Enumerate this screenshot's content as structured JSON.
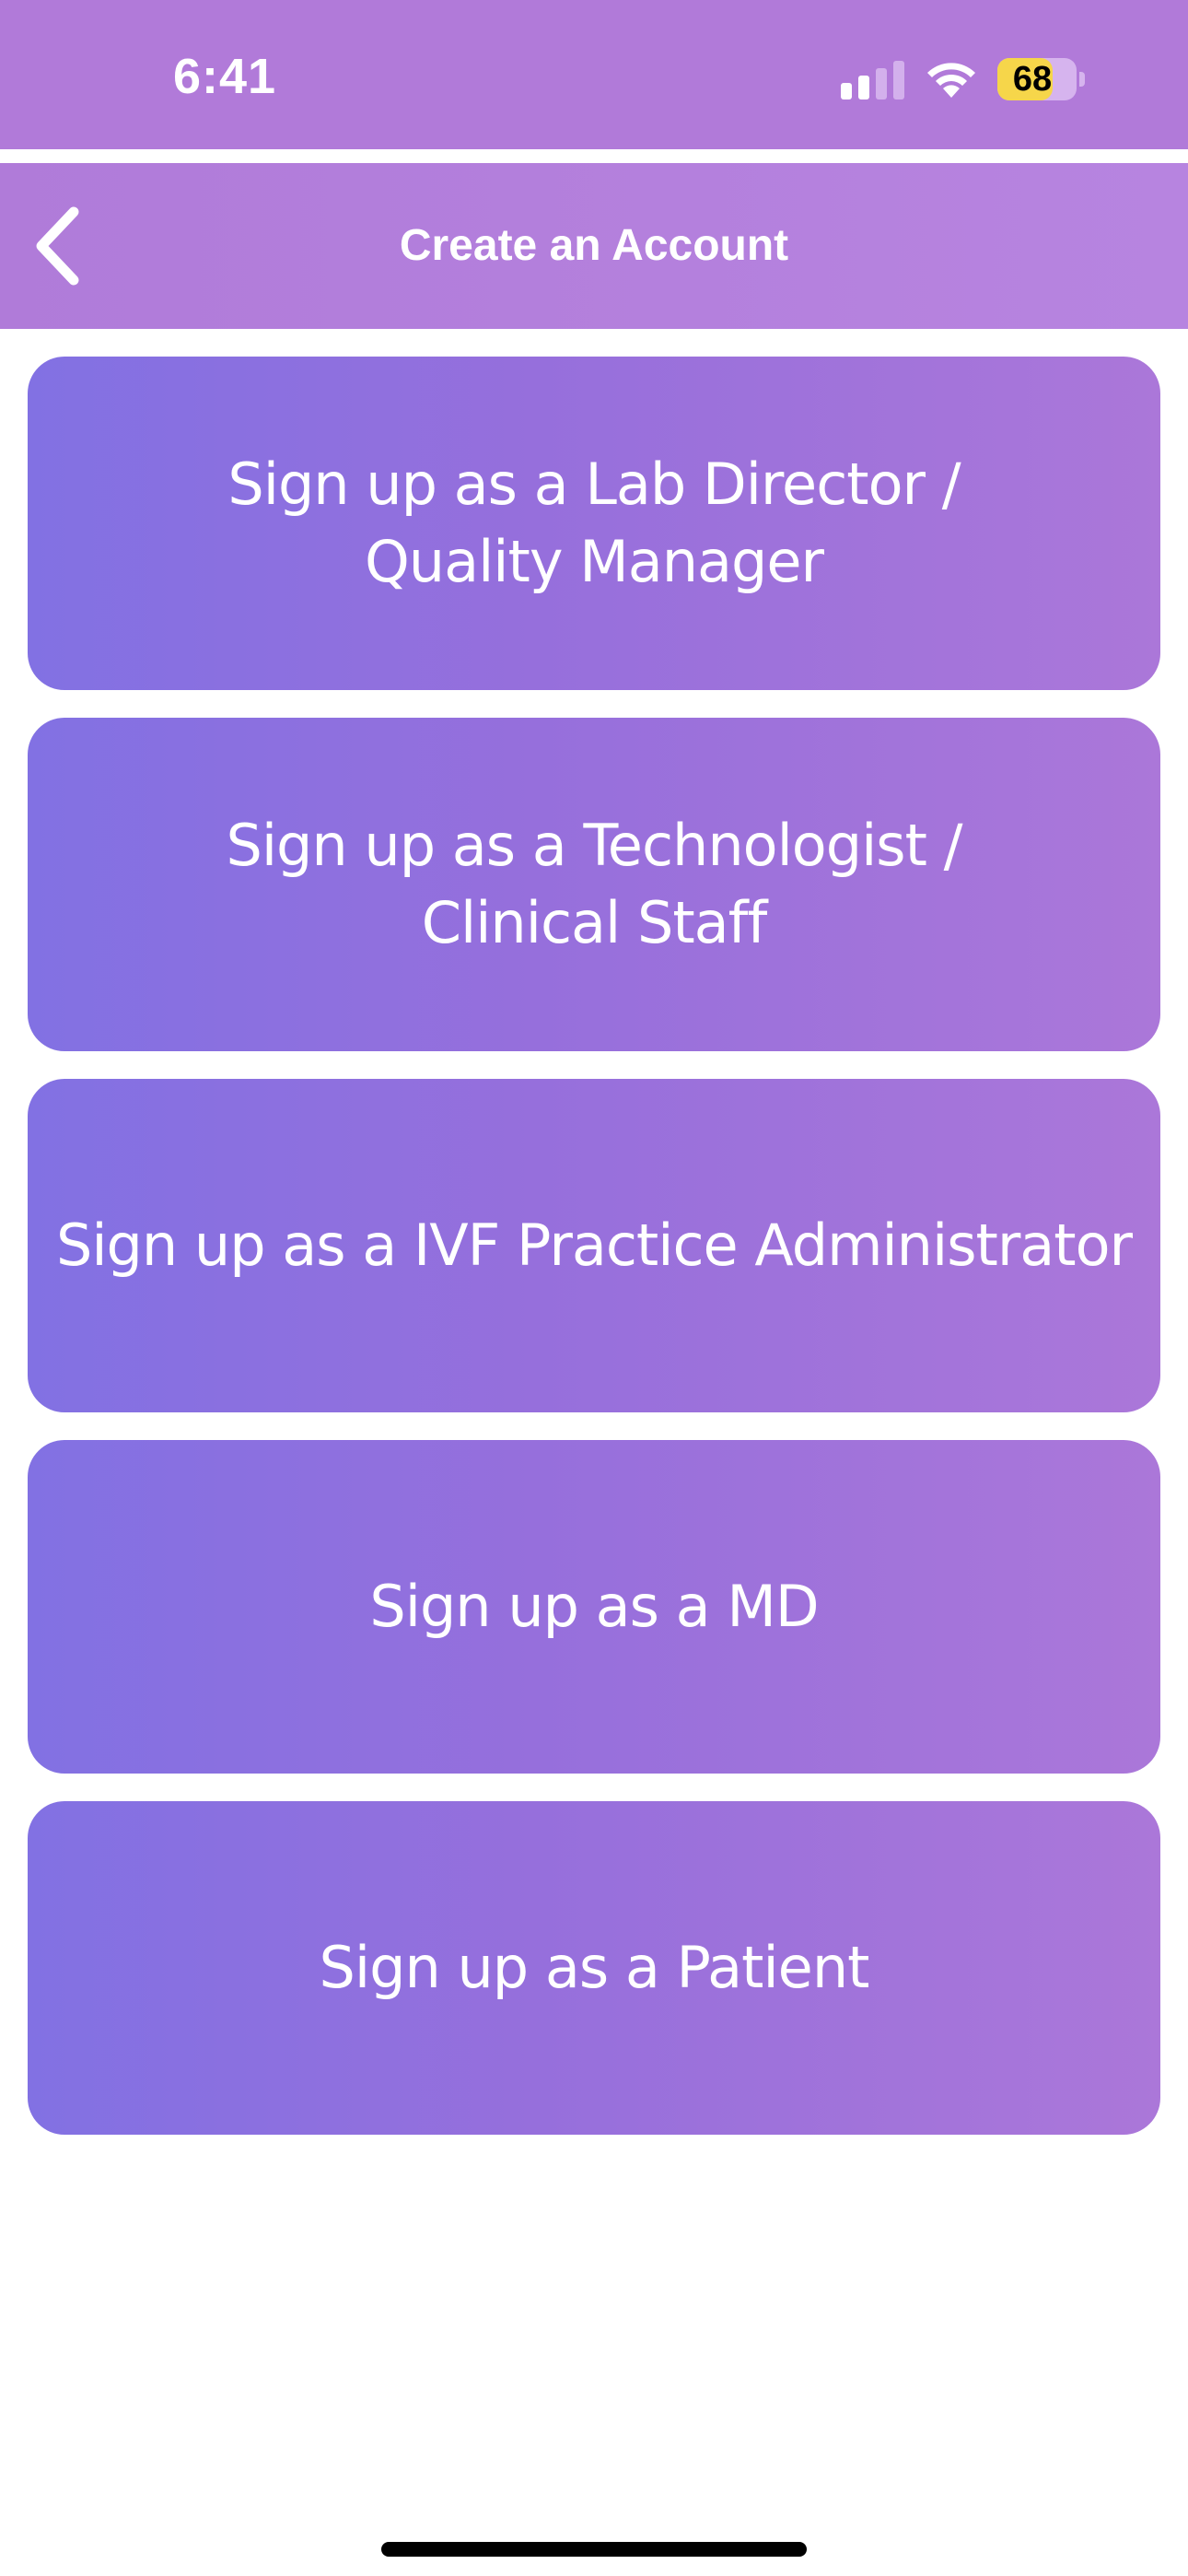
{
  "status_bar": {
    "time": "6:41",
    "battery": "68",
    "background_color": "#b17ad9",
    "icons": [
      "cellular-signal-icon",
      "wifi-icon",
      "battery-icon"
    ]
  },
  "nav": {
    "title": "Create an Account",
    "back_icon": "chevron-left-icon"
  },
  "options": [
    {
      "label": "Sign up as a Lab Director /\nQuality Manager"
    },
    {
      "label": "Sign up as a Technologist /\nClinical Staff"
    },
    {
      "label": "Sign up as a IVF Practice Administrator"
    },
    {
      "label": "Sign up as a MD"
    },
    {
      "label": "Sign up as a Patient"
    }
  ],
  "colors": {
    "button_gradient_start": "#8271e3",
    "button_gradient_end": "#ab77d9",
    "battery_fill": "#f6d64a"
  }
}
